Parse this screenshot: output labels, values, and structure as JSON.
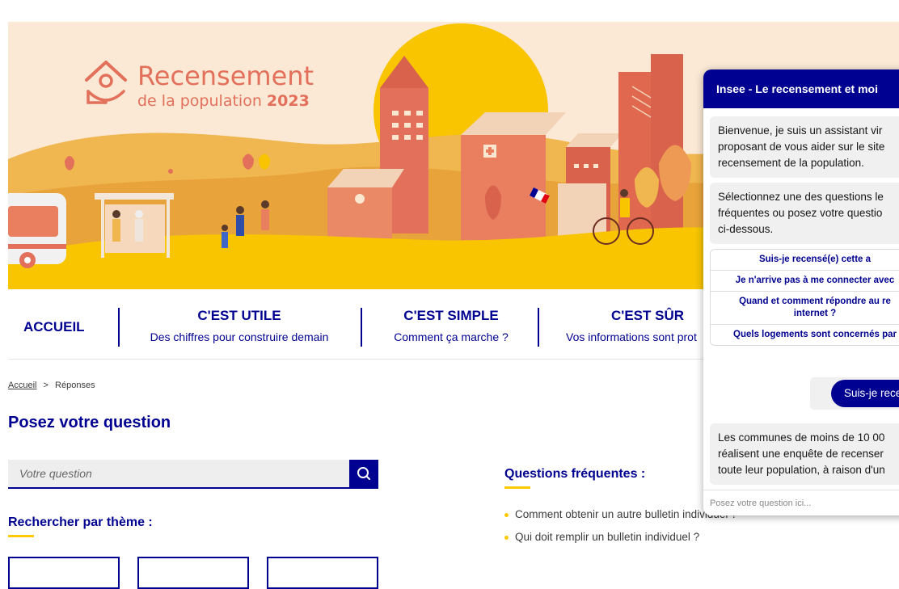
{
  "hero": {
    "logo_title": "Recensement",
    "logo_subtitle": "de la population",
    "logo_year": "2023"
  },
  "nav": {
    "home_label": "ACCUEIL",
    "items": [
      {
        "title": "C'EST UTILE",
        "subtitle": "Des chiffres pour construire demain"
      },
      {
        "title": "C'EST SIMPLE",
        "subtitle": "Comment ça marche ?"
      },
      {
        "title": "C'EST SÛR",
        "subtitle": "Vos informations sont prot"
      }
    ]
  },
  "breadcrumb": {
    "home": "Accueil",
    "separator": ">",
    "current": "Réponses"
  },
  "page": {
    "title": "Posez votre question",
    "search_placeholder": "Votre question",
    "theme_heading": "Rechercher par thème :",
    "faq_heading": "Questions fréquentes :",
    "faq": [
      "Comment obtenir un autre bulletin individuel ?",
      "Qui doit remplir un bulletin individuel ?"
    ]
  },
  "chat": {
    "title": "Insee - Le recensement et moi",
    "welcome_lines": [
      "Bienvenue, je suis un assistant vir",
      "proposant de vous aider sur le site",
      "recensement de la population."
    ],
    "prompt_lines": [
      "Sélectionnez une des questions le",
      "fréquentes ou posez votre questio",
      "ci-dessous."
    ],
    "quick_questions": [
      "Suis-je recensé(e) cette a",
      "Je n'arrive pas à me connecter avec",
      "Quand et comment répondre au re internet ?",
      "Quels logements sont concernés par"
    ],
    "user_message": "Suis-je rece",
    "answer_lines": [
      "Les communes de moins de 10 00",
      "réalisent une enquête de recenser",
      "toute leur population, à raison d'un"
    ],
    "input_placeholder": "Posez votre question ici..."
  },
  "colors": {
    "primary": "#000091",
    "accent": "#ffca00",
    "sun": "#f8c500",
    "terracotta": "#e2705a"
  }
}
